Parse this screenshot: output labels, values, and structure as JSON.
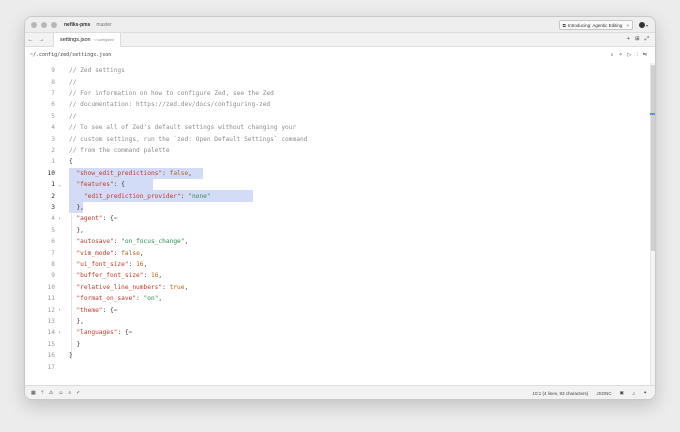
{
  "titlebar": {
    "project": "nefiks-pms",
    "branch": "master",
    "announcement": "Introducing: Agentic Editing",
    "announcement_close": "×"
  },
  "tabbar": {
    "back": "←",
    "forward": "→",
    "tab_name": "settings.json",
    "tab_path": "~/.config/zed",
    "icons": {
      "new": "+",
      "split": "⊞",
      "expand": "⤢"
    }
  },
  "breadcrumb": {
    "path": "~/.config/zed/settings.json",
    "icons": [
      "search-icon",
      "ai-assist-icon",
      "run-icon",
      "outline-icon",
      "settings-sliders-icon"
    ]
  },
  "editor": {
    "lines": [
      {
        "num": "9",
        "current": false,
        "fold": "",
        "tokens": [
          {
            "t": "// Zed settings",
            "c": "comment"
          }
        ]
      },
      {
        "num": "8",
        "current": false,
        "fold": "",
        "tokens": [
          {
            "t": "//",
            "c": "comment"
          }
        ]
      },
      {
        "num": "7",
        "current": false,
        "fold": "",
        "tokens": [
          {
            "t": "// For information on how to configure Zed, see the Zed",
            "c": "comment"
          }
        ]
      },
      {
        "num": "6",
        "current": false,
        "fold": "",
        "tokens": [
          {
            "t": "// documentation: https://zed.dev/docs/configuring-zed",
            "c": "comment"
          }
        ]
      },
      {
        "num": "5",
        "current": false,
        "fold": "",
        "tokens": [
          {
            "t": "//",
            "c": "comment"
          }
        ]
      },
      {
        "num": "4",
        "current": false,
        "fold": "",
        "tokens": [
          {
            "t": "// To see all of Zed's default settings without changing your",
            "c": "comment"
          }
        ]
      },
      {
        "num": "3",
        "current": false,
        "fold": "",
        "tokens": [
          {
            "t": "// custom settings, run the `zed: Open Default Settings` command",
            "c": "comment"
          }
        ]
      },
      {
        "num": "2",
        "current": false,
        "fold": "",
        "tokens": [
          {
            "t": "// from the command palette",
            "c": "comment"
          }
        ]
      },
      {
        "num": "1",
        "current": false,
        "fold": "",
        "tokens": [
          {
            "t": "{",
            "c": "punct"
          }
        ]
      },
      {
        "num": "10",
        "current": true,
        "fold": "",
        "sel": 134,
        "tokens": [
          {
            "t": "  ",
            "c": "punct"
          },
          {
            "t": "\"show_edit_predictions\"",
            "c": "key"
          },
          {
            "t": ": ",
            "c": "punct"
          },
          {
            "t": "false",
            "c": "bool"
          },
          {
            "t": ",",
            "c": "punct"
          }
        ]
      },
      {
        "num": "1",
        "current": true,
        "fold": "⌄",
        "sel": 84,
        "tokens": [
          {
            "t": "  ",
            "c": "punct"
          },
          {
            "t": "\"features\"",
            "c": "key"
          },
          {
            "t": ": {",
            "c": "punct"
          }
        ]
      },
      {
        "num": "2",
        "current": true,
        "fold": "",
        "sel": 184,
        "tokens": [
          {
            "t": "    ",
            "c": "punct"
          },
          {
            "t": "\"edit_prediction_provider\"",
            "c": "key"
          },
          {
            "t": ": ",
            "c": "punct"
          },
          {
            "t": "\"none\"",
            "c": "str"
          }
        ]
      },
      {
        "num": "3",
        "current": true,
        "fold": "",
        "sel": 14,
        "tokens": [
          {
            "t": "  },",
            "c": "punct"
          }
        ]
      },
      {
        "num": "4",
        "current": false,
        "fold": "›",
        "tokens": [
          {
            "t": "  ",
            "c": "punct"
          },
          {
            "t": "\"agent\"",
            "c": "key"
          },
          {
            "t": ": {",
            "c": "punct"
          },
          {
            "t": "⋯",
            "c": "ell"
          }
        ]
      },
      {
        "num": "5",
        "current": false,
        "fold": "",
        "tokens": [
          {
            "t": "  },",
            "c": "punct"
          }
        ]
      },
      {
        "num": "6",
        "current": false,
        "fold": "",
        "tokens": [
          {
            "t": "  ",
            "c": "punct"
          },
          {
            "t": "\"autosave\"",
            "c": "key"
          },
          {
            "t": ": ",
            "c": "punct"
          },
          {
            "t": "\"on_focus_change\"",
            "c": "str"
          },
          {
            "t": ",",
            "c": "punct"
          }
        ]
      },
      {
        "num": "7",
        "current": false,
        "fold": "",
        "tokens": [
          {
            "t": "  ",
            "c": "punct"
          },
          {
            "t": "\"vim_mode\"",
            "c": "key"
          },
          {
            "t": ": ",
            "c": "punct"
          },
          {
            "t": "false",
            "c": "bool"
          },
          {
            "t": ",",
            "c": "punct"
          }
        ]
      },
      {
        "num": "8",
        "current": false,
        "fold": "",
        "tokens": [
          {
            "t": "  ",
            "c": "punct"
          },
          {
            "t": "\"ui_font_size\"",
            "c": "key"
          },
          {
            "t": ": ",
            "c": "punct"
          },
          {
            "t": "16",
            "c": "num"
          },
          {
            "t": ",",
            "c": "punct"
          }
        ]
      },
      {
        "num": "9",
        "current": false,
        "fold": "",
        "tokens": [
          {
            "t": "  ",
            "c": "punct"
          },
          {
            "t": "\"buffer_font_size\"",
            "c": "key"
          },
          {
            "t": ": ",
            "c": "punct"
          },
          {
            "t": "16",
            "c": "num"
          },
          {
            "t": ",",
            "c": "punct"
          }
        ]
      },
      {
        "num": "10",
        "current": false,
        "fold": "",
        "tokens": [
          {
            "t": "  ",
            "c": "punct"
          },
          {
            "t": "\"relative_line_numbers\"",
            "c": "key"
          },
          {
            "t": ": ",
            "c": "punct"
          },
          {
            "t": "true",
            "c": "bool"
          },
          {
            "t": ",",
            "c": "punct"
          }
        ]
      },
      {
        "num": "11",
        "current": false,
        "fold": "",
        "tokens": [
          {
            "t": "  ",
            "c": "punct"
          },
          {
            "t": "\"format_on_save\"",
            "c": "key"
          },
          {
            "t": ": ",
            "c": "punct"
          },
          {
            "t": "\"on\"",
            "c": "str"
          },
          {
            "t": ",",
            "c": "punct"
          }
        ]
      },
      {
        "num": "12",
        "current": false,
        "fold": "›",
        "tokens": [
          {
            "t": "  ",
            "c": "punct"
          },
          {
            "t": "\"theme\"",
            "c": "key"
          },
          {
            "t": ": {",
            "c": "punct"
          },
          {
            "t": "⋯",
            "c": "ell"
          }
        ]
      },
      {
        "num": "13",
        "current": false,
        "fold": "",
        "tokens": [
          {
            "t": "  },",
            "c": "punct"
          }
        ]
      },
      {
        "num": "14",
        "current": false,
        "fold": "›",
        "tokens": [
          {
            "t": "  ",
            "c": "punct"
          },
          {
            "t": "\"languages\"",
            "c": "key"
          },
          {
            "t": ": {",
            "c": "punct"
          },
          {
            "t": "⋯",
            "c": "ell"
          }
        ]
      },
      {
        "num": "15",
        "current": false,
        "fold": "",
        "tokens": [
          {
            "t": "  }",
            "c": "punct"
          }
        ]
      },
      {
        "num": "16",
        "current": false,
        "fold": "",
        "tokens": [
          {
            "t": "}",
            "c": "punct"
          }
        ]
      },
      {
        "num": "17",
        "current": false,
        "fold": "",
        "tokens": []
      }
    ]
  },
  "statusbar": {
    "left_icons": [
      "project-panel-icon",
      "git-icon",
      "diagnostics-icon",
      "collab-icon",
      "search-icon",
      "check-icon"
    ],
    "cursor_position": "10:1 (4 lines, 93 characters)",
    "language": "JSONC",
    "right_icons": [
      "terminal-icon",
      "bell-icon",
      "assistant-icon"
    ]
  },
  "colors": {
    "selection": "#d2dcf7",
    "comment": "#8e8e8e",
    "key": "#c0392b",
    "string": "#2e8b57",
    "number": "#b5651d"
  }
}
